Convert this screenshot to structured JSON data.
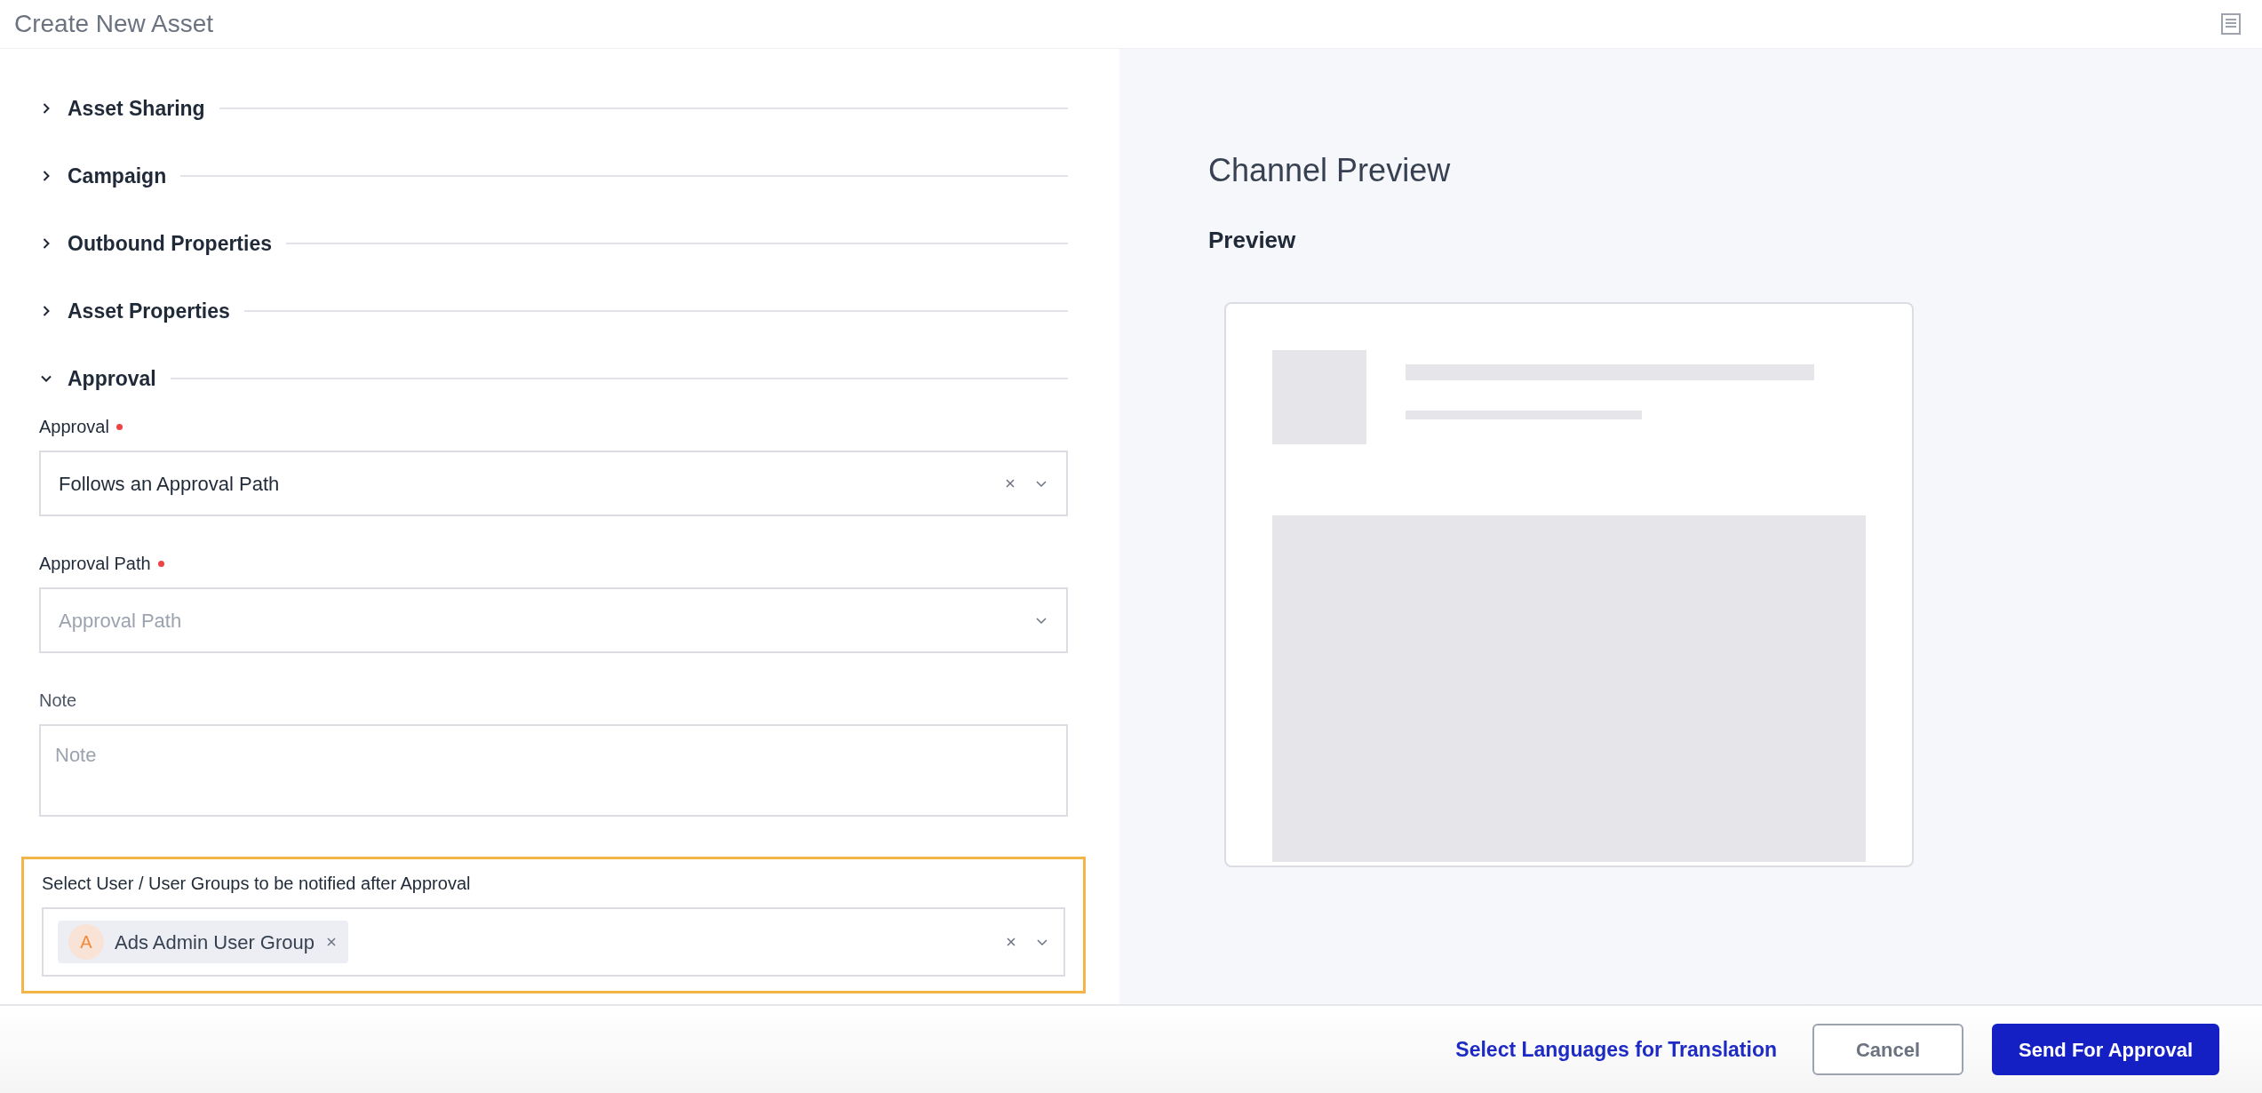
{
  "header": {
    "title": "Create New Asset"
  },
  "sections": [
    {
      "title": "Asset Sharing",
      "expanded": false
    },
    {
      "title": "Campaign",
      "expanded": false
    },
    {
      "title": "Outbound Properties",
      "expanded": false
    },
    {
      "title": "Asset Properties",
      "expanded": false
    },
    {
      "title": "Approval",
      "expanded": true
    }
  ],
  "approval_fields": [
    {
      "kind": "select",
      "label": "Approval",
      "required": true,
      "value": "Follows an Approval Path",
      "clearable": true
    },
    {
      "kind": "select",
      "label": "Approval Path",
      "required": true,
      "placeholder": "Approval Path",
      "clearable": false
    },
    {
      "kind": "textarea",
      "label": "Note",
      "required": false,
      "placeholder": "Note"
    },
    {
      "kind": "multiselect",
      "label": "Select User / User Groups to be notified after Approval",
      "required": false,
      "highlighted": true,
      "clearable": true,
      "tags": [
        {
          "initial": "A",
          "label": "Ads Admin User Group"
        }
      ]
    }
  ],
  "preview": {
    "title": "Channel Preview",
    "subtitle": "Preview"
  },
  "footer": {
    "link": "Select Languages for Translation",
    "buttons": [
      {
        "label": "Cancel",
        "kind": "secondary"
      },
      {
        "label": "Send For Approval",
        "kind": "primary"
      }
    ]
  }
}
